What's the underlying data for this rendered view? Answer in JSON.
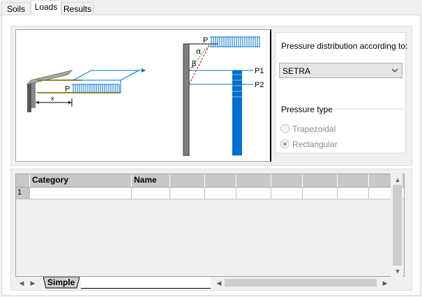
{
  "tabs": [
    {
      "label": "Soils",
      "active": false
    },
    {
      "label": "Loads",
      "active": true
    },
    {
      "label": "Results",
      "active": false
    }
  ],
  "diagram": {
    "load_label": "P",
    "distance_label": "x",
    "wall_load_label": "P",
    "alpha_label": "α",
    "beta_label": "β",
    "p1_label": "P1",
    "p2_label": "P2"
  },
  "pressure_distribution": {
    "label": "Pressure distribution according to:",
    "selected": "SETRA"
  },
  "pressure_type": {
    "label": "Pressure type",
    "options": [
      {
        "label": "Trapezoidal",
        "checked": false
      },
      {
        "label": "Rectangular",
        "checked": true
      }
    ]
  },
  "table": {
    "columns": [
      "Category",
      "Name",
      "",
      "",
      "",
      "",
      "",
      "",
      ""
    ],
    "rows": [
      {
        "index": "1",
        "cells": [
          "",
          "",
          "",
          "",
          "",
          "",
          "",
          "",
          ""
        ]
      }
    ]
  },
  "sheet_tabs": [
    "Simple"
  ],
  "colors": {
    "accent_blue": "#0070d0",
    "load_olive": "#8a8a2a",
    "wall_gray": "#808080"
  }
}
